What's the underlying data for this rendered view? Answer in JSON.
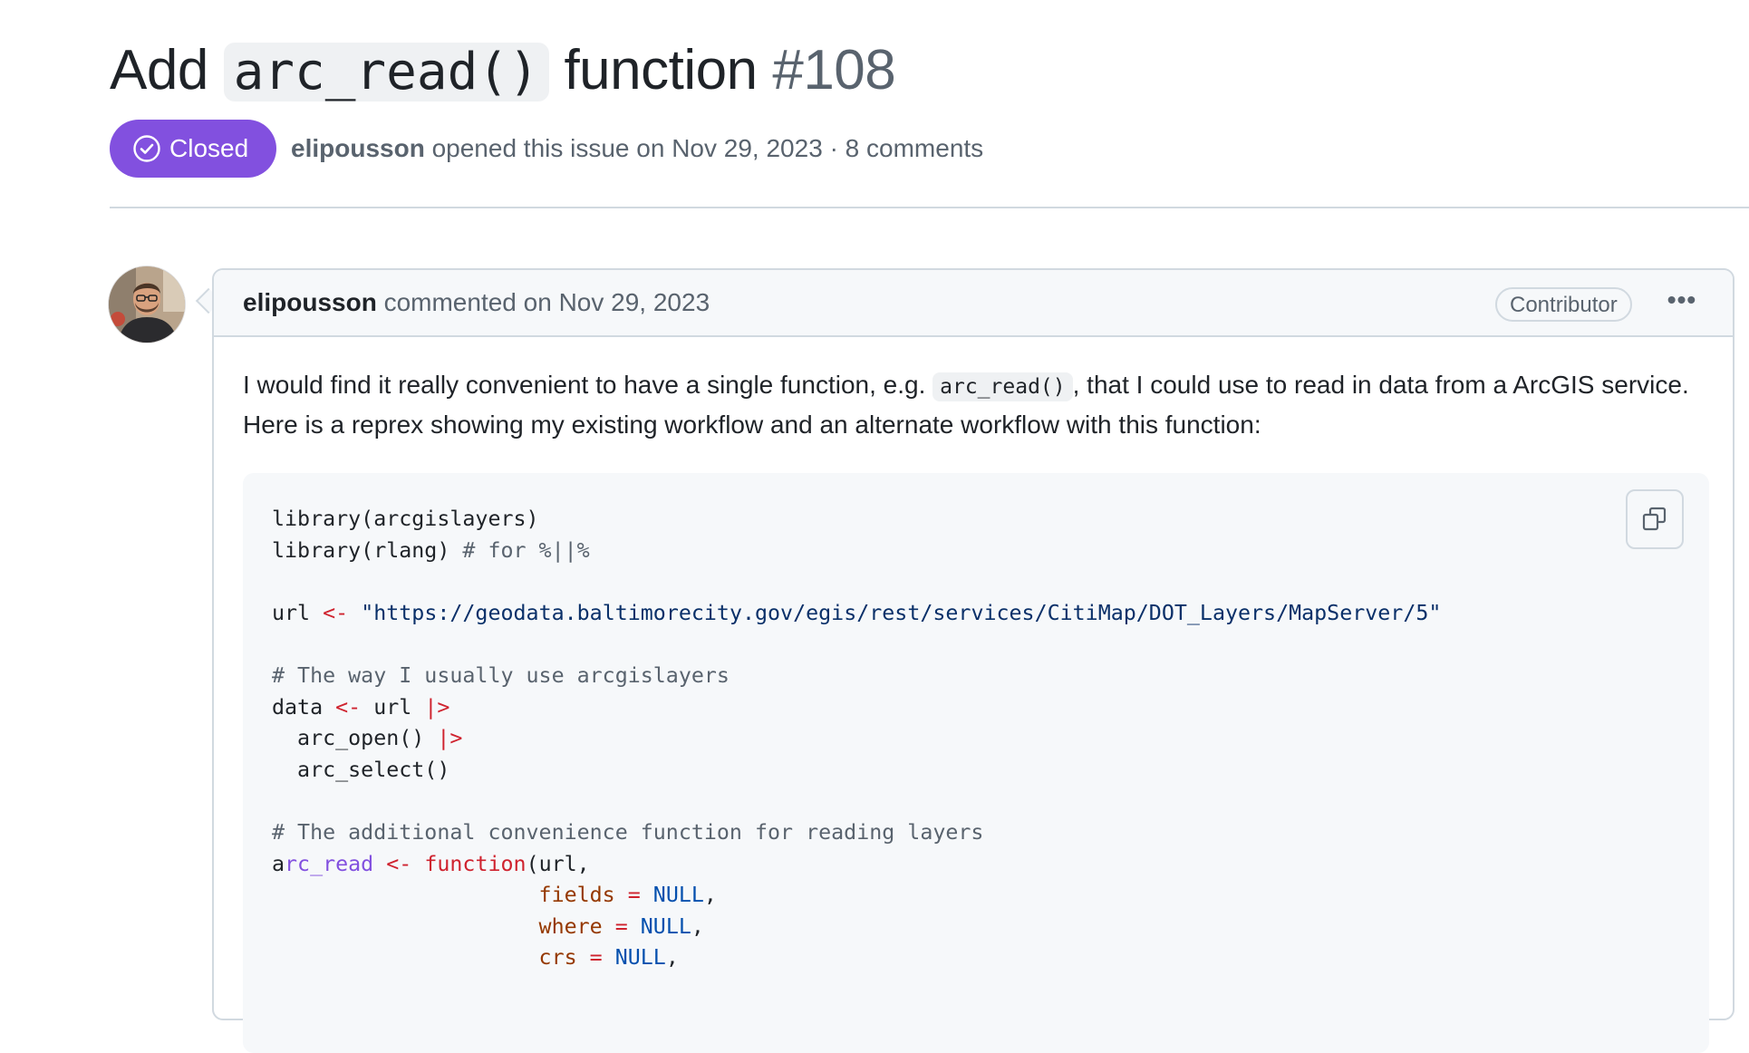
{
  "issue": {
    "title_prefix": "Add",
    "title_code": "arc_read()",
    "title_suffix": "function",
    "number": "#108",
    "state": "Closed",
    "author": "elipousson",
    "opened_text": "opened this issue on Nov 29, 2023",
    "separator": "·",
    "comments": "8 comments"
  },
  "comment": {
    "author": "elipousson",
    "action": "commented on Nov 29, 2023",
    "badge": "Contributor",
    "more": "•••",
    "text_before": "I would find it really convenient to have a single function, e.g.",
    "inline_code": "arc_read()",
    "text_after": ", that I could use to read in data from a ArcGIS service. Here is a reprex showing my existing workflow and an alternate workflow with this function:",
    "code_lines": [
      "library(arcgislayers)",
      "library(rlang) # for %||%",
      "",
      "url <- \"https://geodata.baltimorecity.gov/egis/rest/services/CitiMap/DOT_Layers/MapServer/5\"",
      "",
      "# The way I usually use arcgislayers",
      "data <- url |>",
      "  arc_open() |>",
      "  arc_select()",
      "",
      "# The additional convenience function for reading layers",
      "arc_read <- function(url,",
      "                     fields = NULL,",
      "                     where = NULL,",
      "                     crs = NULL,"
    ]
  },
  "colors": {
    "closed_badge": "#8250df",
    "border": "#d1d9e0",
    "muted_text": "#59636e",
    "code_bg": "#f6f8fa"
  },
  "icons": [
    "check-circle-icon",
    "copy-icon",
    "kebab-horizontal-icon"
  ]
}
